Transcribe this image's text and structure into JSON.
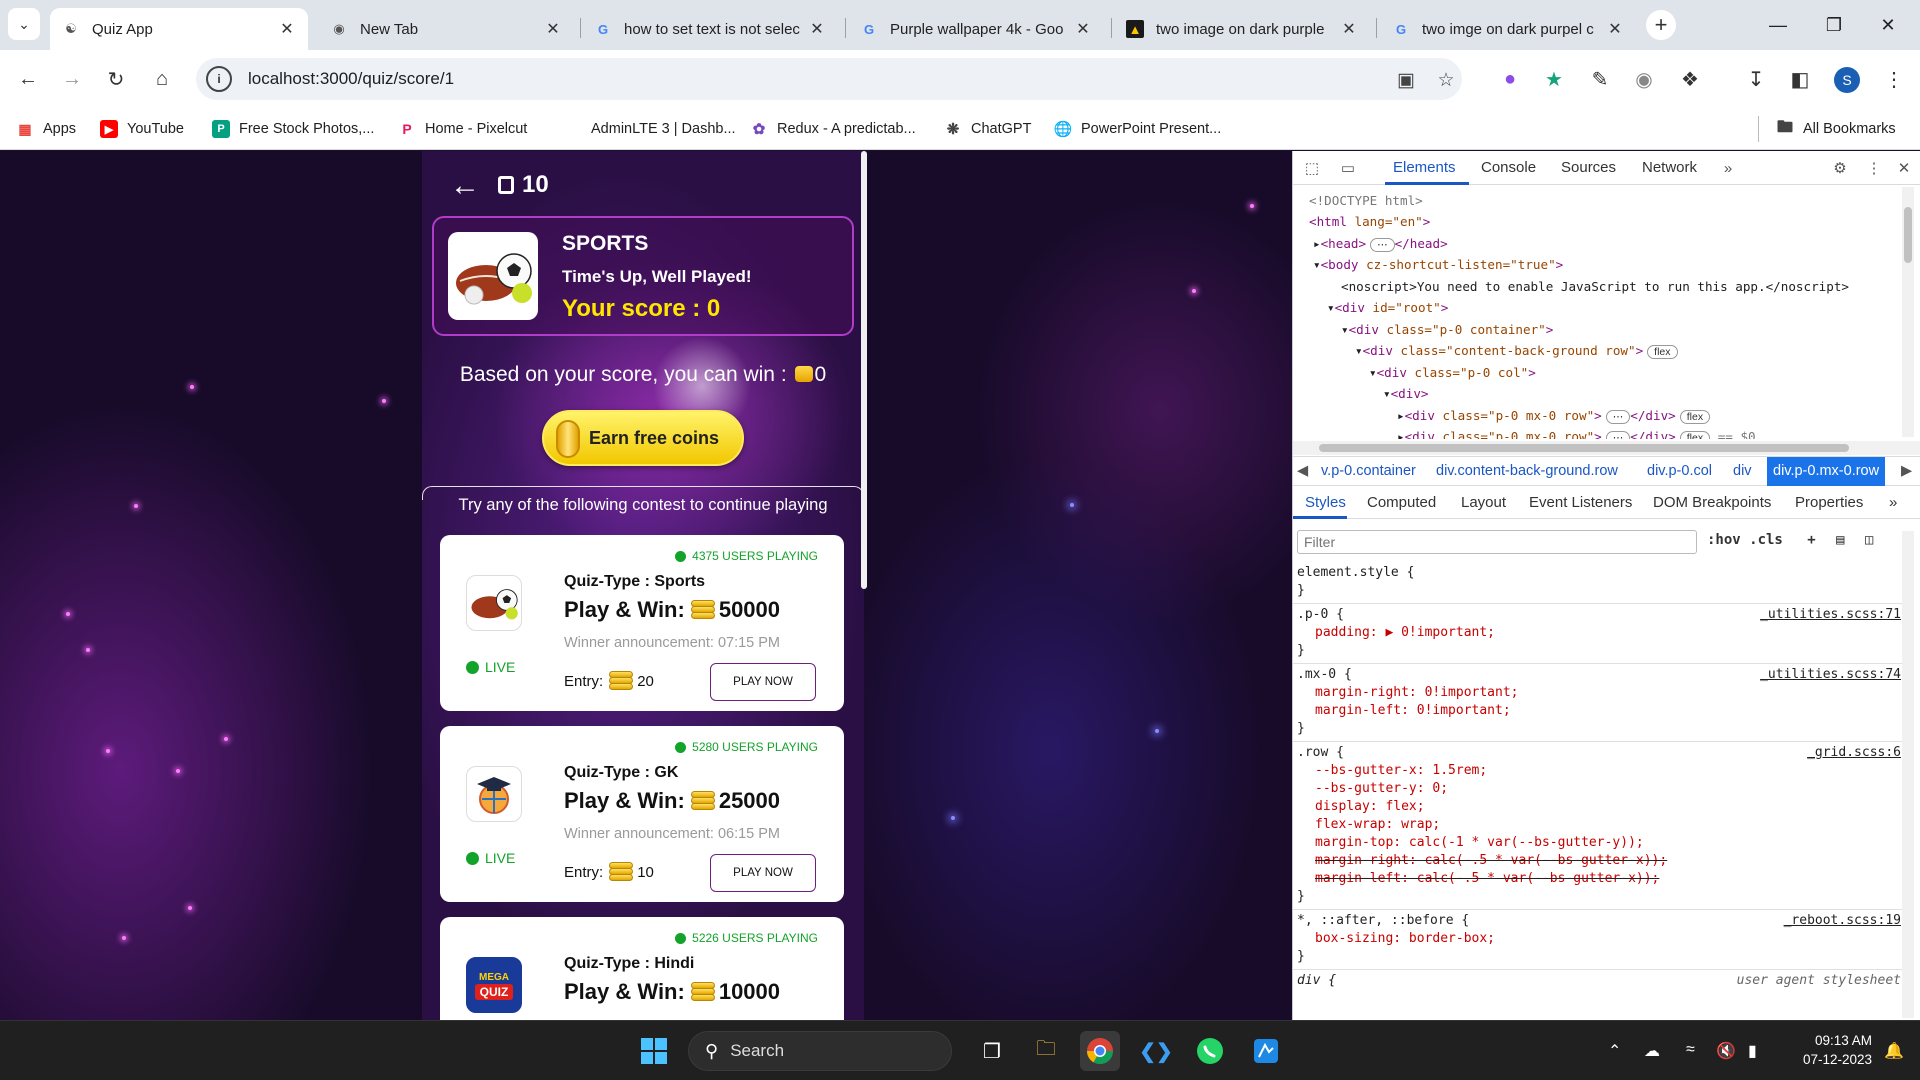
{
  "browser": {
    "tabs": [
      {
        "title": "Quiz App",
        "icon": "quiz-brain-icon",
        "active": true
      },
      {
        "title": "New Tab",
        "icon": "chrome-icon",
        "active": false
      },
      {
        "title": "how to set text is not selec",
        "icon": "google-icon",
        "active": false
      },
      {
        "title": "Purple wallpaper 4k - Goo",
        "icon": "google-icon",
        "active": false
      },
      {
        "title": "two image on dark purple",
        "icon": "image-icon",
        "active": false
      },
      {
        "title": "two imge on dark purpel c",
        "icon": "google-icon",
        "active": false
      }
    ],
    "url": "localhost:3000/quiz/score/1",
    "bookmarks": [
      {
        "label": "Apps",
        "icon": "apps-grid-icon"
      },
      {
        "label": "YouTube",
        "icon": "youtube-icon",
        "color": "#ff0000"
      },
      {
        "label": "Free Stock Photos,...",
        "icon": "pexels-icon",
        "color": "#05a081"
      },
      {
        "label": "Home - Pixelcut",
        "icon": "pixelcut-icon",
        "color": "#e9195a"
      },
      {
        "label": "AdminLTE 3 | Dashb...",
        "icon": "adminlte-icon"
      },
      {
        "label": "Redux - A predictab...",
        "icon": "redux-icon",
        "color": "#764abc"
      },
      {
        "label": "ChatGPT",
        "icon": "chatgpt-icon"
      },
      {
        "label": "PowerPoint Present...",
        "icon": "globe-icon"
      }
    ],
    "all_bookmarks": "All Bookmarks",
    "profile_initial": "S"
  },
  "app": {
    "coins": "10",
    "result": {
      "category": "SPORTS",
      "message": "Time's Up, Well Played!",
      "score_text": "Your score : 0"
    },
    "win_prefix": "Based on your score, you can win :",
    "win_amount": "0",
    "earn_button": "Earn free coins",
    "try_text": "Try any of the following contest to continue playing",
    "contests": [
      {
        "users": "4375 USERS PLAYING",
        "type": "Quiz-Type : Sports",
        "prize_label": "Play & Win:",
        "prize": "50000",
        "winner": "Winner announcement: 07:15 PM",
        "status": "LIVE",
        "entry_label": "Entry:",
        "entry": "20",
        "button": "PLAY NOW",
        "thumb": "sports-balls-icon"
      },
      {
        "users": "5280 USERS PLAYING",
        "type": "Quiz-Type : GK",
        "prize_label": "Play & Win:",
        "prize": "25000",
        "winner": "Winner announcement: 06:15 PM",
        "status": "LIVE",
        "entry_label": "Entry:",
        "entry": "10",
        "button": "PLAY NOW",
        "thumb": "graduation-globe-icon"
      },
      {
        "users": "5226 USERS PLAYING",
        "type": "Quiz-Type : Hindi",
        "prize_label": "Play & Win:",
        "prize": "10000",
        "winner": "",
        "status": "",
        "entry_label": "",
        "entry": "",
        "button": "",
        "thumb": "mega-quiz-icon"
      }
    ],
    "accent": "#ffe600",
    "live_color": "#14a32a"
  },
  "devtools": {
    "tabs": [
      "Elements",
      "Console",
      "Sources",
      "Network"
    ],
    "dom": [
      {
        "text": "<!DOCTYPE html>"
      },
      {
        "tag": "html",
        "attrs": "lang=\"en\""
      },
      {
        "tag": "head",
        "collapsed": "</head>"
      },
      {
        "tag": "body",
        "attrs": "cz-shortcut-listen=\"true\""
      },
      {
        "text": "<noscript>You need to enable JavaScript to run this app.</noscript>"
      },
      {
        "tag": "div",
        "attrs": "id=\"root\""
      },
      {
        "tag": "div",
        "attrs": "class=\"p-0 container\""
      },
      {
        "tag": "div",
        "attrs": "class=\"content-back-ground row\"",
        "badge": "flex"
      },
      {
        "tag": "div",
        "attrs": "class=\"p-0 col\""
      },
      {
        "tag": "div"
      },
      {
        "tag": "div",
        "attrs": "class=\"p-0 mx-0 row\"",
        "badge": "flex"
      },
      {
        "tag": "div",
        "attrs": "class=\"p-0 mx-0   row\"",
        "badge": "flex",
        "suffix": "== $0"
      }
    ],
    "breadcrumbs": [
      "v.p-0.container",
      "div.content-back-ground.row",
      "div.p-0.col",
      "div",
      "div.p-0.mx-0.row"
    ],
    "styles_tabs": [
      "Styles",
      "Computed",
      "Layout",
      "Event Listeners",
      "DOM Breakpoints",
      "Properties"
    ],
    "filter_placeholder": "Filter",
    "filter_tools": ":hov .cls",
    "rules": [
      {
        "selector": "element.style {",
        "source": ""
      },
      {
        "selector": ".p-0 {",
        "source": "_utilities.scss:71",
        "props": [
          "padding: ▶ 0!important;"
        ]
      },
      {
        "selector": ".mx-0 {",
        "source": "_utilities.scss:74",
        "props": [
          "margin-right: 0!important;",
          "margin-left: 0!important;"
        ]
      },
      {
        "selector": ".row {",
        "source": "_grid.scss:6",
        "props": [
          "--bs-gutter-x: 1.5rem;",
          "--bs-gutter-y: 0;",
          "display: flex;",
          "flex-wrap: wrap;",
          "margin-top: calc(-1 * var(--bs-gutter-y));",
          "margin-right: calc(-.5 * var(--bs-gutter-x));",
          "margin-left: calc(-.5 * var(--bs-gutter-x));"
        ]
      },
      {
        "selector": "*, ::after, ::before {",
        "source": "_reboot.scss:19",
        "props": [
          "box-sizing: border-box;"
        ]
      },
      {
        "selector": "div {",
        "source": "user agent stylesheet"
      }
    ]
  },
  "taskbar": {
    "search": "Search",
    "time": "09:13 AM",
    "date": "07-12-2023"
  }
}
